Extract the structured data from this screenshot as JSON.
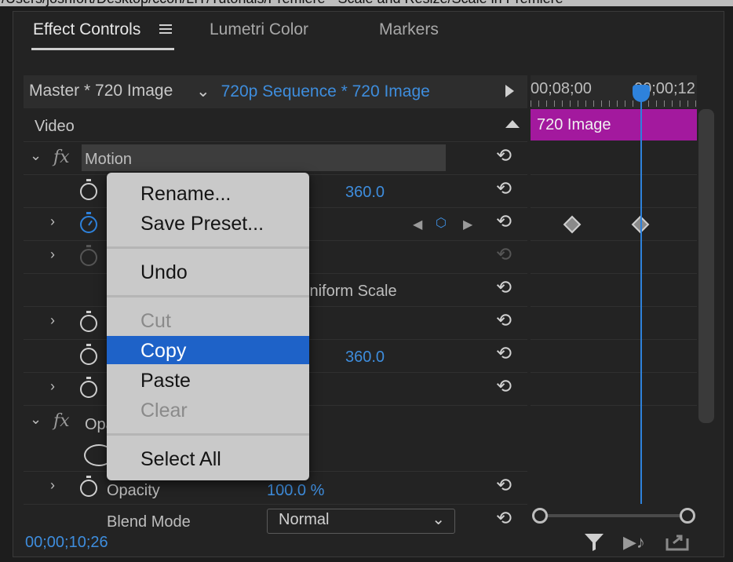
{
  "window": {
    "path_text": "/Users/joshfort/Desktop/ccon/LIT/Tutorials/Premiere - Scale and Resize/Scale in Premiere"
  },
  "tabs": [
    {
      "label": "Effect Controls",
      "active": true,
      "menu_icon": "hamburger-menu-icon"
    },
    {
      "label": "Lumetri Color"
    },
    {
      "label": "Markers"
    }
  ],
  "header": {
    "master": "Master * 720 Image",
    "sequence": "720p Sequence * 720 Image",
    "chevron_icon": "chevron-down-icon",
    "play_icon": "play-triangle-icon"
  },
  "timeline": {
    "tc_left": "00;08;00",
    "tc_right": "00;00;12",
    "clip_label": "720 Image",
    "playhead_color": "#2e82dc",
    "clip_color": "#a3199e"
  },
  "effects": {
    "section_label": "Video",
    "motion_label": "Motion",
    "position_value": "360.0",
    "uniform_scale_label": "Uniform Scale",
    "anchor_value": "360.0",
    "opacity_section_label": "Opacity",
    "opacity_label": "Opacity",
    "opacity_value": "100.0 %",
    "blend_mode_label": "Blend Mode",
    "blend_mode_value": "Normal",
    "fx_symbol": "fx"
  },
  "context_menu": {
    "items": [
      {
        "label": "Rename...",
        "enabled": true
      },
      {
        "label": "Save Preset...",
        "enabled": true
      },
      {
        "label": "Undo",
        "enabled": true
      },
      {
        "label": "Cut",
        "enabled": false
      },
      {
        "label": "Copy",
        "enabled": true,
        "highlighted": true
      },
      {
        "label": "Paste",
        "enabled": true
      },
      {
        "label": "Clear",
        "enabled": false
      },
      {
        "label": "Select All",
        "enabled": true
      }
    ]
  },
  "footer": {
    "timecode": "00;00;10;26",
    "icons": [
      "filter-icon",
      "play-audio-icon",
      "export-icon"
    ]
  },
  "colors": {
    "accent": "#3e8ddd",
    "menu_highlight": "#1e62c8"
  }
}
